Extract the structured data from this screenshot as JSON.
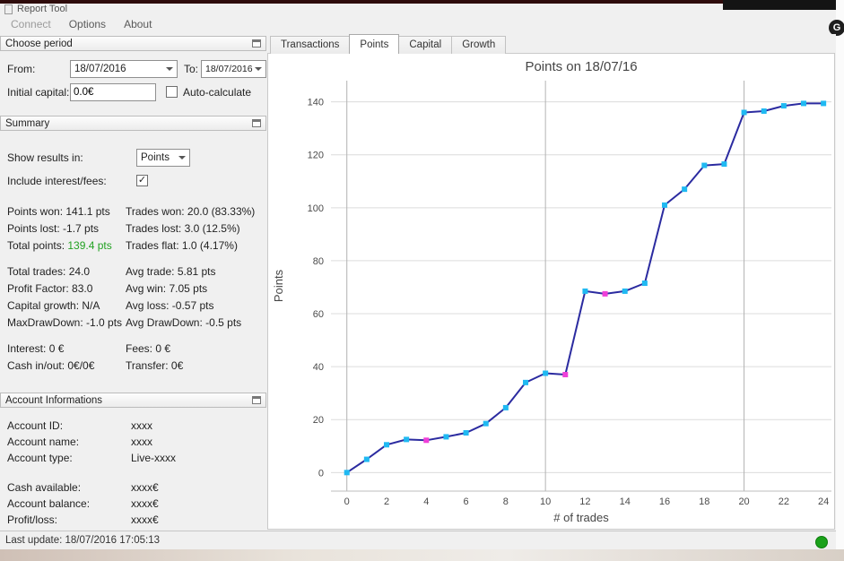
{
  "window": {
    "title": "Report Tool",
    "menu": [
      {
        "label": "Connect",
        "muted": true
      },
      {
        "label": "Options",
        "muted": false
      },
      {
        "label": "About",
        "muted": false
      }
    ],
    "status": {
      "last_update": "Last update: 18/07/2016 17:05:13"
    }
  },
  "external": {
    "g_icon_label": "G"
  },
  "panels": {
    "choose_period": {
      "title": "Choose period",
      "from_label": "From:",
      "from_value": "18/07/2016",
      "to_label": "To:",
      "to_value": "18/07/2016",
      "initial_capital_label": "Initial capital:",
      "initial_capital_value": "0.0€",
      "auto_calculate_label": "Auto-calculate",
      "auto_calculate_checked": false
    },
    "summary": {
      "title": "Summary",
      "show_results_label": "Show results in:",
      "show_results_value": "Points",
      "include_interest_label": "Include interest/fees:",
      "include_interest_checked": true,
      "stats_groups": [
        [
          {
            "left": "Points won: 141.1 pts",
            "right": "Trades won: 20.0 (83.33%)"
          },
          {
            "left": "Points lost: -1.7 pts",
            "right": "Trades lost: 3.0 (12.5%)"
          },
          {
            "left_label": "Total points:",
            "left_value": "139.4 pts",
            "left_value_color": "#21a121",
            "right": "Trades flat: 1.0 (4.17%)"
          }
        ],
        [
          {
            "left": "Total trades: 24.0",
            "right": "Avg trade: 5.81 pts"
          },
          {
            "left": "Profit Factor: 83.0",
            "right": "Avg win: 7.05 pts"
          },
          {
            "left": "Capital growth: N/A",
            "right": "Avg loss: -0.57 pts"
          },
          {
            "left": "MaxDrawDown: -1.0 pts",
            "right": "Avg DrawDown: -0.5 pts"
          }
        ],
        [
          {
            "left": "Interest: 0 €",
            "right": "Fees: 0 €"
          },
          {
            "left": "Cash in/out: 0€/0€",
            "right": "Transfer: 0€"
          }
        ]
      ]
    },
    "account": {
      "title": "Account Informations",
      "groups": [
        [
          {
            "label": "Account ID:",
            "value": "xxxx"
          },
          {
            "label": "Account name:",
            "value": "xxxx"
          },
          {
            "label": "Account type:",
            "value": "Live-xxxx"
          }
        ],
        [
          {
            "label": "Cash available:",
            "value": "xxxx€"
          },
          {
            "label": "Account balance:",
            "value": "xxxx€"
          },
          {
            "label": "Profit/loss:",
            "value": "xxxx€"
          }
        ]
      ]
    }
  },
  "tabs": {
    "items": [
      "Transactions",
      "Points",
      "Capital",
      "Growth"
    ],
    "active": "Points"
  },
  "chart_data": {
    "type": "line",
    "title": "Points on 18/07/16",
    "xlabel": "# of trades",
    "ylabel": "Points",
    "x": [
      0,
      1,
      2,
      3,
      4,
      5,
      6,
      7,
      8,
      9,
      10,
      11,
      12,
      13,
      14,
      15,
      16,
      17,
      18,
      19,
      20,
      21,
      22,
      23,
      24
    ],
    "y": [
      0,
      5,
      10.5,
      12.5,
      12.2,
      13.5,
      15,
      18.5,
      24.5,
      34,
      37.5,
      37,
      68.5,
      67.5,
      68.5,
      71.5,
      101,
      107,
      116,
      116.5,
      136,
      136.5,
      138.5,
      139.4,
      139.4
    ],
    "xticks": [
      0,
      2,
      4,
      6,
      8,
      10,
      12,
      14,
      16,
      18,
      20,
      22,
      24
    ],
    "yticks": [
      0,
      20,
      40,
      60,
      80,
      100,
      120,
      140
    ],
    "xlim": [
      -0.8,
      24.4
    ],
    "ylim": [
      -7,
      148
    ],
    "major_vgrid": [
      0,
      10,
      20
    ],
    "grid": true,
    "legend": null,
    "marker": "square",
    "line_color": "#2b2ba0",
    "marker_color": "#1fb9f2",
    "loss_marker_color": "#ef3fd8",
    "loss_indices": [
      4,
      11,
      13
    ]
  }
}
